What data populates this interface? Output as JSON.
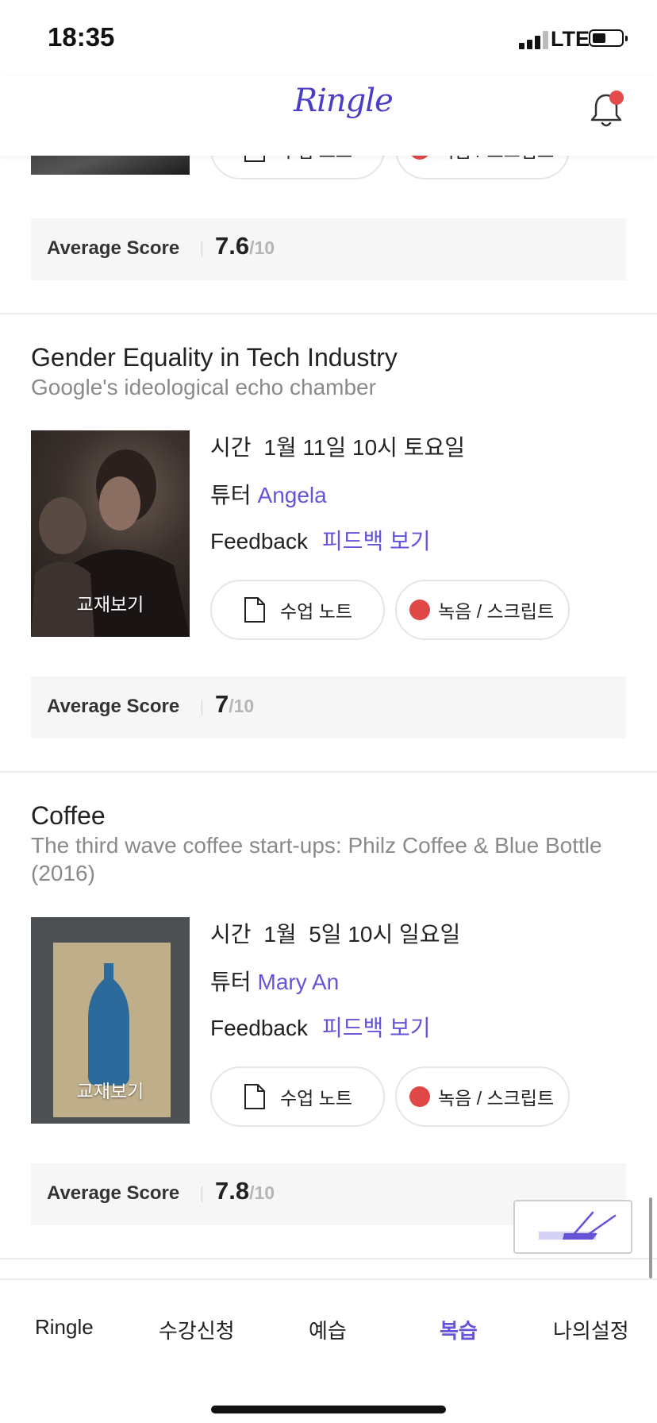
{
  "status_bar": {
    "time": "18:35",
    "network": "LTE"
  },
  "header": {
    "logo": "Ringle"
  },
  "top_card": {
    "note_label": "수업 노트",
    "recording_label": "녹음 / 스크립트",
    "score_label": "Average Score",
    "score_value": "7.6",
    "score_outof": "/10"
  },
  "lessons": [
    {
      "title": "Gender Equality in Tech Industry",
      "subtitle": "Google's ideological echo chamber",
      "thumb_label": "교재보기",
      "time_label": "시간",
      "time_value": "1월 11일 10시 토요일",
      "tutor_label": "튜터",
      "tutor_name": "Angela",
      "feedback_label": "Feedback",
      "feedback_link": "피드백 보기",
      "note_label": "수업 노트",
      "recording_label": "녹음 / 스크립트",
      "score_label": "Average Score",
      "score_value": "7",
      "score_outof": "/10"
    },
    {
      "title": "Coffee",
      "subtitle": "The third wave coffee start-ups: Philz Coffee & Blue Bottle (2016)",
      "thumb_label": "교재보기",
      "time_label": "시간",
      "time_value": "1월  5일 10시 일요일",
      "tutor_label": "튜터",
      "tutor_name": "Mary An",
      "feedback_label": "Feedback",
      "feedback_link": "피드백 보기",
      "note_label": "수업 노트",
      "recording_label": "녹음 / 스크립트",
      "score_label": "Average Score",
      "score_value": "7.8",
      "score_outof": "/10"
    }
  ],
  "bottom_nav": {
    "items": [
      {
        "label": "Ringle"
      },
      {
        "label": "수강신청"
      },
      {
        "label": "예습"
      },
      {
        "label": "복습",
        "active": true
      },
      {
        "label": "나의설정"
      }
    ]
  },
  "colors": {
    "accent": "#6354d8",
    "record_dot": "#e04848",
    "notification_dot": "#e44c4c"
  }
}
